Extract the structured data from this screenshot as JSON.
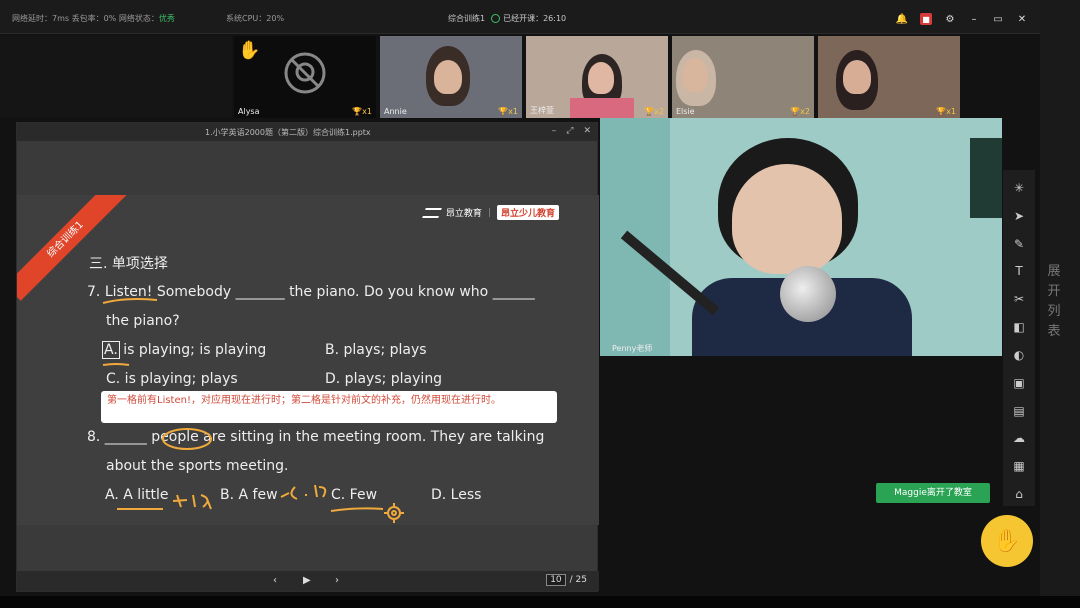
{
  "topbar": {
    "status_prefix": "网络延时：7ms 丢包率：0% 网络状态：",
    "network_state": "优秀",
    "cpu": "系统CPU：20%",
    "class_name": "综合训练1",
    "started_label": "已经开课：",
    "elapsed": "26:10"
  },
  "students": [
    {
      "name": "Alysa",
      "award": "x1",
      "cam_off": true
    },
    {
      "name": "Annie",
      "award": "x1"
    },
    {
      "name": "王梓萱",
      "award": "x2"
    },
    {
      "name": "Elsie",
      "award": "x2"
    },
    {
      "name": "",
      "award": "x1"
    }
  ],
  "ppt": {
    "filename": "1.小学英语2000题（第二版）综合训练1.pptx",
    "ribbon_label": "综合训练1",
    "brand_name": "昂立教育",
    "brand_badge": "昂立少儿教育",
    "section_title": "三. 单项选择",
    "q7_line1_a": "7. ",
    "q7_line1_b": "Listen!",
    "q7_line1_c": " Somebody _______ the piano. Do you know who ______",
    "q7_line2": "the piano?",
    "q7_a_letter": "A.",
    "q7_a": " is playing; is playing",
    "q7_b": "B. plays; plays",
    "q7_c": "C. is playing; plays",
    "q7_d": "D. plays; playing",
    "note": "第一格前有Listen!，对应用现在进行时；第二格是针对前文的补充，仍然用现在进行时。",
    "q8_line1_a": "8. ______ ",
    "q8_line1_b": "people",
    "q8_line1_c": " are sitting in the meeting room. They are talking",
    "q8_line2": "about the sports meeting.",
    "q8_a": "A. A little",
    "q8_b": "B. A few",
    "q8_c": "C. Few",
    "q8_d": "D. Less",
    "current_page": "10",
    "total_pages": "/ 25"
  },
  "teacher": {
    "name": "Penny老师"
  },
  "side": {
    "expand_list": "展开列表"
  },
  "toast": "Maggie离开了教室",
  "colors": {
    "accent": "#2aa355",
    "ribbon": "#e0452a",
    "hand": "#f6c632"
  }
}
